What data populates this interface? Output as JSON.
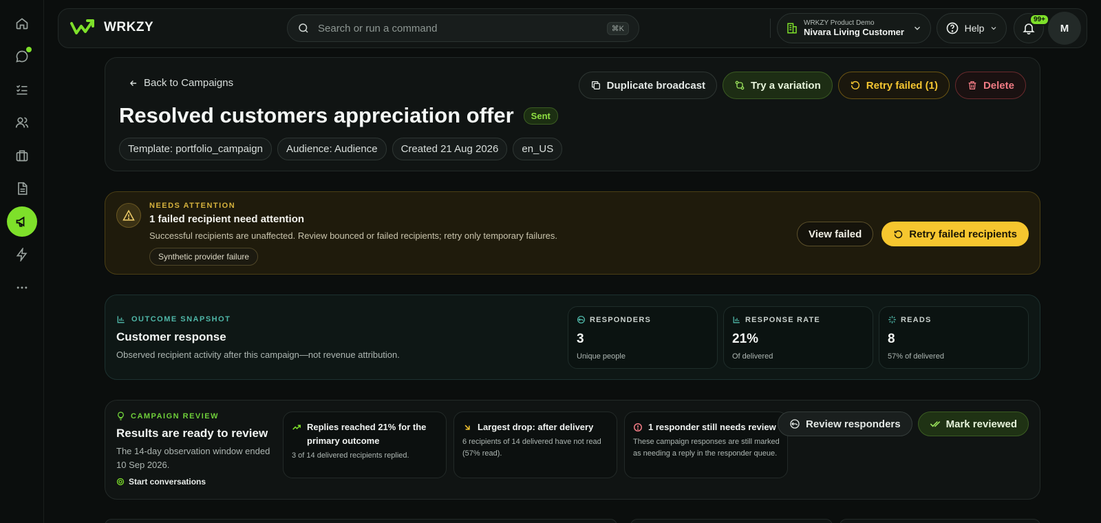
{
  "brand": {
    "name": "WRKZY"
  },
  "search": {
    "placeholder": "Search or run a command",
    "shortcut": "⌘K"
  },
  "workspace": {
    "org": "WRKZY Product Demo",
    "name": "Nivara Living Customer C..."
  },
  "help": {
    "label": "Help"
  },
  "notifications": {
    "badge": "99+"
  },
  "user": {
    "initial": "M"
  },
  "sidebar": {
    "items": [
      {
        "name": "home",
        "icon": "home-icon",
        "active": false
      },
      {
        "name": "chats",
        "icon": "chat-bubble-icon",
        "active": false,
        "dot": true
      },
      {
        "name": "tasks",
        "icon": "checklist-icon",
        "active": false
      },
      {
        "name": "contacts",
        "icon": "users-icon",
        "active": false
      },
      {
        "name": "catalog",
        "icon": "briefcase-icon",
        "active": false
      },
      {
        "name": "templates",
        "icon": "document-icon",
        "active": false
      },
      {
        "name": "campaigns",
        "icon": "megaphone-icon",
        "active": true
      },
      {
        "name": "automations",
        "icon": "lightning-icon",
        "active": false
      },
      {
        "name": "more",
        "icon": "more-dots-icon",
        "active": false
      }
    ]
  },
  "campaign": {
    "back_label": "Back to Campaigns",
    "title": "Resolved customers appreciation offer",
    "status": "Sent",
    "chips": [
      "Template: portfolio_campaign",
      "Audience: Audience",
      "Created 21 Aug 2026",
      "en_US"
    ],
    "actions": {
      "duplicate": "Duplicate broadcast",
      "variation": "Try a variation",
      "retry": "Retry failed (1)",
      "delete": "Delete"
    }
  },
  "attention": {
    "kicker": "NEEDS ATTENTION",
    "title": "1 failed recipient need attention",
    "description": "Successful recipients are unaffected. Review bounced or failed recipients; retry only temporary failures.",
    "reason_chip": "Synthetic provider failure",
    "view_failed": "View failed",
    "retry_failed": "Retry failed recipients"
  },
  "outcome": {
    "kicker": "OUTCOME SNAPSHOT",
    "title": "Customer response",
    "description": "Observed recipient activity after this campaign—not revenue attribution.",
    "metrics": [
      {
        "label": "RESPONDERS",
        "value": "3",
        "sub": "Unique people",
        "icon": "reply-icon"
      },
      {
        "label": "RESPONSE RATE",
        "value": "21%",
        "sub": "Of delivered",
        "icon": "bar-chart-icon"
      },
      {
        "label": "READS",
        "value": "8",
        "sub": "57% of delivered",
        "icon": "sparkle-icon"
      }
    ]
  },
  "review": {
    "kicker": "CAMPAIGN REVIEW",
    "title": "Results are ready to review",
    "description": "The 14-day observation window ended 10 Sep 2026.",
    "link": "Start conversations",
    "insights": [
      {
        "title": "Replies reached 21% for the primary outcome",
        "desc": "3 of 14 delivered recipients replied.",
        "icon": "trend-up-icon",
        "color": "#7ee02a"
      },
      {
        "title": "Largest drop: after delivery",
        "desc": "6 recipients of 14 delivered have not read (57% read).",
        "icon": "arrow-down-right-icon",
        "color": "#f4c531"
      },
      {
        "title": "1 responder still needs review",
        "desc": "These campaign responses are still marked as needing a reply in the responder queue.",
        "icon": "alert-circle-icon",
        "color": "#f07b84"
      }
    ],
    "review_responders": "Review responders",
    "mark_reviewed": "Mark reviewed"
  },
  "colors": {
    "accent": "#7ee02a",
    "amber": "#f4c531",
    "danger": "#f07b84",
    "teal": "#4fb7a8"
  }
}
